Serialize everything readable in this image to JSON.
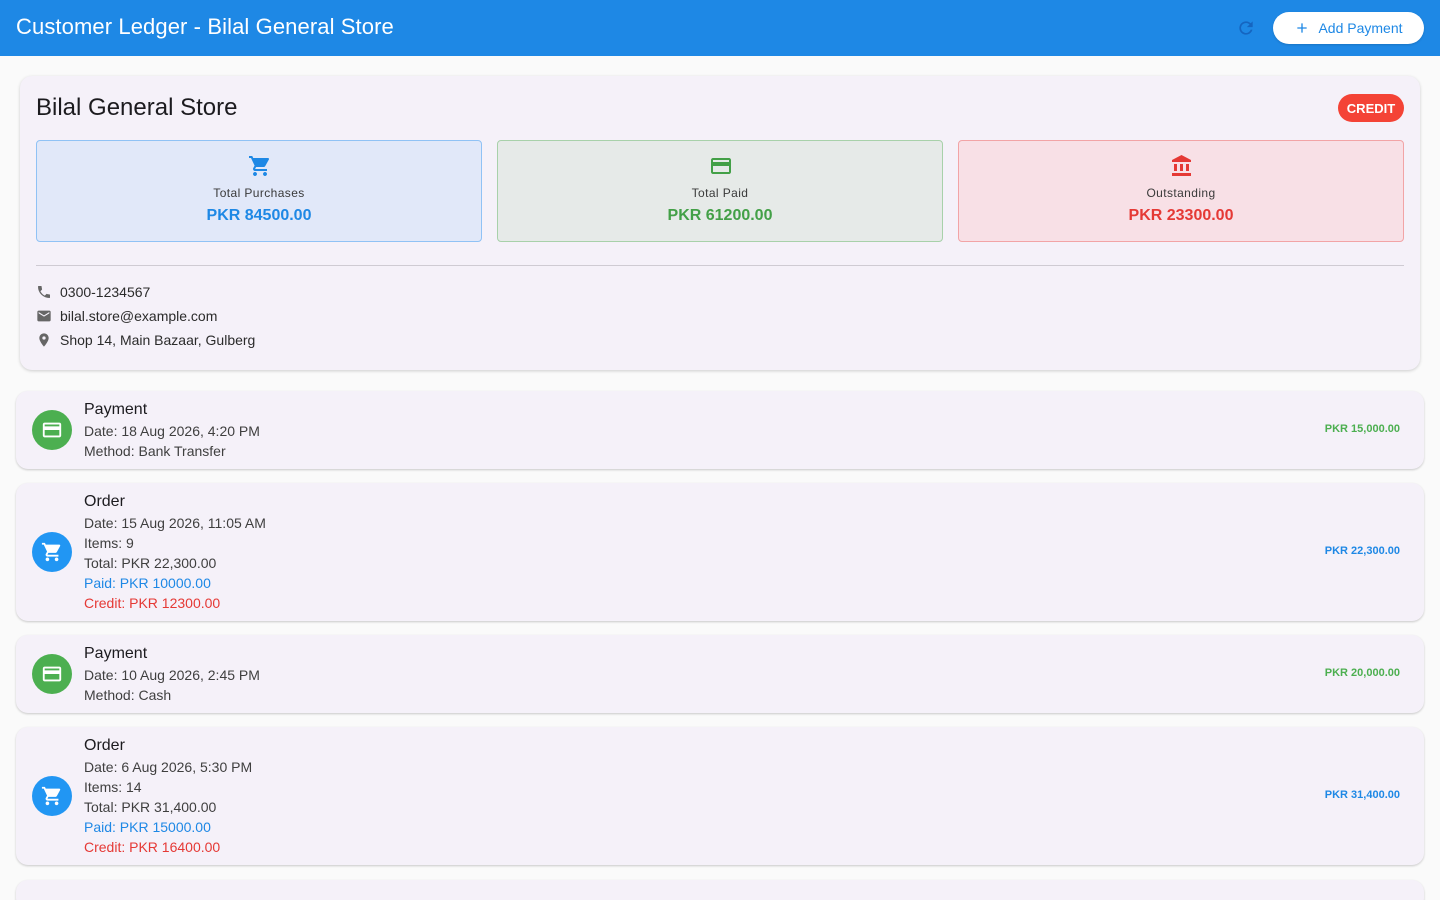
{
  "appbar": {
    "title": "Customer Ledger - Bilal General Store",
    "add_payment_label": "Add Payment",
    "refresh_icon": "refresh-icon",
    "add_icon": "plus-icon",
    "color": "#1e88e5"
  },
  "customer": {
    "name": "Bilal General Store",
    "badge": "CREDIT",
    "phone": "0300-1234567",
    "email": "bilal.store@example.com",
    "address": "Shop 14, Main Bazaar, Gulberg"
  },
  "stats": {
    "purchases": {
      "label": "Total Purchases",
      "value": "PKR 84500.00",
      "icon": "cart-icon",
      "color": "#1e88e5"
    },
    "paid": {
      "label": "Total Paid",
      "value": "PKR 61200.00",
      "icon": "credit-card-icon",
      "color": "#43a047"
    },
    "outstanding": {
      "label": "Outstanding",
      "value": "PKR 23300.00",
      "icon": "bank-icon",
      "color": "#e53935"
    }
  },
  "transactions": [
    {
      "type": "Payment",
      "date": "Date: 18 Aug 2026, 4:20 PM",
      "method": "Method: Bank Transfer",
      "amount": "PKR 15,000.00"
    },
    {
      "type": "Order",
      "date": "Date: 15 Aug 2026, 11:05 AM",
      "items": "Items: 9",
      "total": "Total: PKR 22,300.00",
      "paid": "Paid: PKR 10000.00",
      "credit": "Credit: PKR 12300.00",
      "amount": "PKR 22,300.00"
    },
    {
      "type": "Payment",
      "date": "Date: 10 Aug 2026, 2:45 PM",
      "method": "Method: Cash",
      "amount": "PKR 20,000.00"
    },
    {
      "type": "Order",
      "date": "Date: 6 Aug 2026, 5:30 PM",
      "items": "Items: 14",
      "total": "Total: PKR 31,400.00",
      "paid": "Paid: PKR 15000.00",
      "credit": "Credit: PKR 16400.00",
      "amount": "PKR 31,400.00"
    }
  ]
}
